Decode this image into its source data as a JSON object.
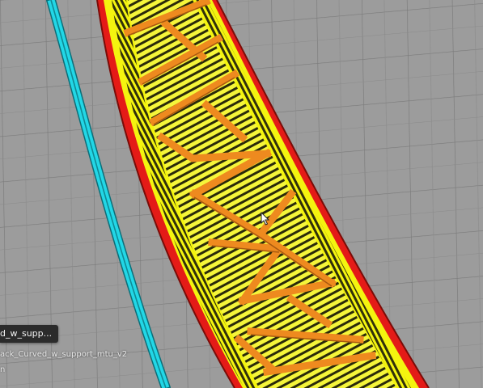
{
  "viewport": {
    "tooltip_text": "d_w_supp...",
    "job_name": "ack_Curved_w_support_mtu_v2",
    "job_sub": "n"
  },
  "colors": {
    "build_plate": "#9a9a9a",
    "grid": "#7d7d7d",
    "outer_wall": "#e41b17",
    "inner_wall": "#f4f40f",
    "infill": "#f2f238",
    "support": "#f08a22",
    "travel": "#22d7e6"
  },
  "icons": {
    "cursor": "mouse-pointer-icon"
  }
}
